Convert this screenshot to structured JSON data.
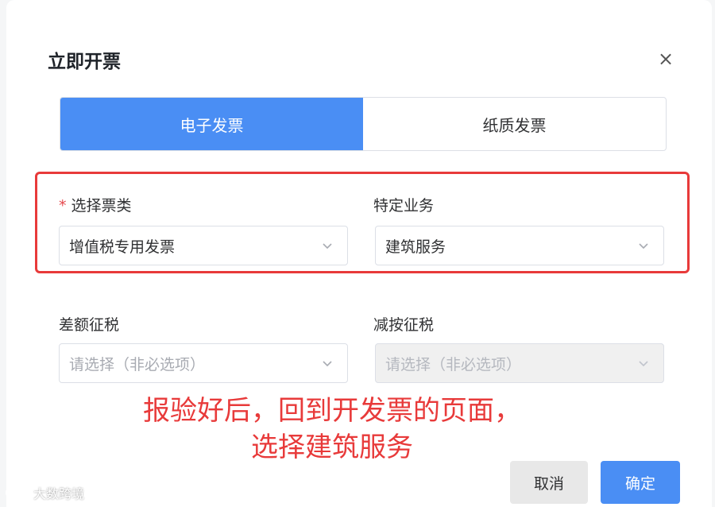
{
  "dialog": {
    "title": "立即开票",
    "close_label": "×"
  },
  "tabs": [
    {
      "label": "电子发票",
      "active": true
    },
    {
      "label": "纸质发票",
      "active": false
    }
  ],
  "fields": {
    "ticket_type": {
      "required_mark": "*",
      "label": "选择票类",
      "value": "增值税专用发票"
    },
    "special_business": {
      "label": "特定业务",
      "value": "建筑服务"
    },
    "difference_tax": {
      "label": "差额征税",
      "placeholder": "请选择（非必选项）"
    },
    "reduced_tax": {
      "label": "减按征税",
      "placeholder": "请选择（非必选项）",
      "disabled": true
    }
  },
  "annotation": {
    "line1": "报验好后，回到开发票的页面，",
    "line2": "选择建筑服务",
    "color": "#e83a3a"
  },
  "buttons": {
    "cancel": "取消",
    "confirm": "确定"
  },
  "watermark": "大数跨境",
  "colors": {
    "accent": "#4a8ef4",
    "highlight": "#e83a3a"
  }
}
